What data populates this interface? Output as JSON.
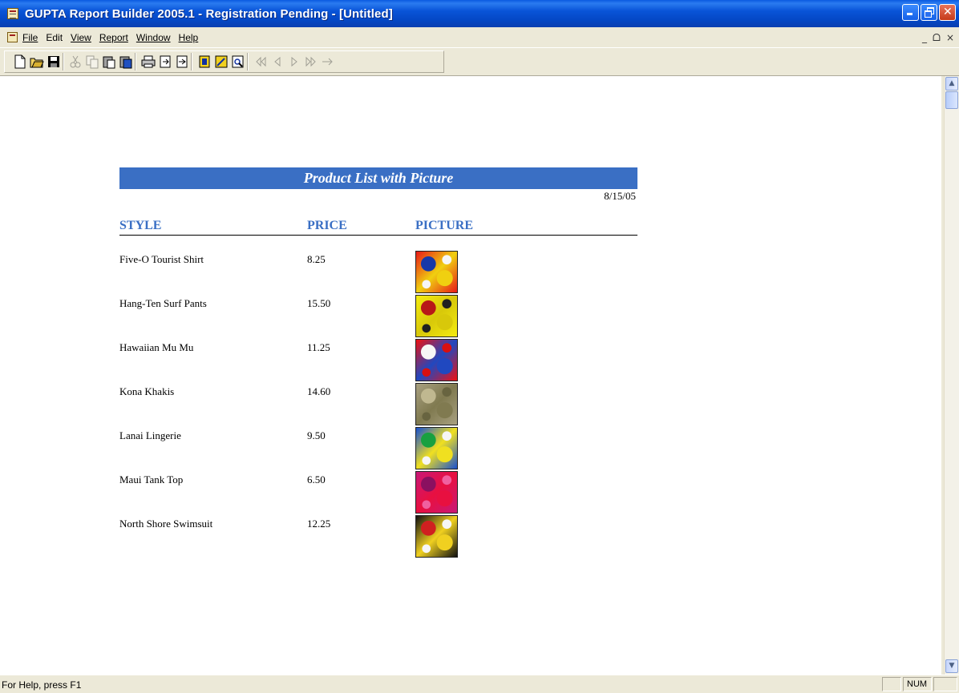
{
  "window": {
    "title": "GUPTA Report Builder 2005.1 - Registration Pending - [Untitled]"
  },
  "menu": {
    "items": [
      {
        "label": "File"
      },
      {
        "label": "Edit"
      },
      {
        "label": "View"
      },
      {
        "label": "Report"
      },
      {
        "label": "Window"
      },
      {
        "label": "Help"
      }
    ],
    "mdi_min": "_",
    "mdi_restore": "ᗝ",
    "mdi_close": "×"
  },
  "toolbar": {
    "icons": [
      "new-icon",
      "open-icon",
      "save-icon",
      "cut-icon",
      "copy-icon",
      "paste-icon",
      "paste-special-icon",
      "print-icon",
      "import-icon",
      "export-icon",
      "help-icon",
      "design-icon",
      "preview-icon",
      "first-page-icon",
      "prev-page-icon",
      "next-page-icon",
      "last-page-icon",
      "goto-page-icon"
    ]
  },
  "report": {
    "title": "Product List with Picture",
    "date": "8/15/05",
    "columns": {
      "style": "STYLE",
      "price": "PRICE",
      "picture": "PICTURE"
    },
    "rows": [
      {
        "style": "Five-O Tourist Shirt",
        "price": "8.25",
        "picture_colors": [
          "#e81818",
          "#f0d010",
          "#1838a8",
          "#f6f6f6"
        ]
      },
      {
        "style": "Hang-Ten Surf Pants",
        "price": "15.50",
        "picture_colors": [
          "#f4ec10",
          "#d8c80a",
          "#b81818",
          "#202020"
        ]
      },
      {
        "style": "Hawaiian Mu Mu",
        "price": "11.25",
        "picture_colors": [
          "#f01010",
          "#2048c0",
          "#f6f6f6",
          "#d81010"
        ]
      },
      {
        "style": "Kona Khakis",
        "price": "14.60",
        "picture_colors": [
          "#a8a080",
          "#807a50",
          "#c0b890",
          "#686440"
        ]
      },
      {
        "style": "Lanai Lingerie",
        "price": "9.50",
        "picture_colors": [
          "#1850d0",
          "#f0e020",
          "#18a040",
          "#f6f6f6"
        ]
      },
      {
        "style": "Maui Tank Top",
        "price": "6.50",
        "picture_colors": [
          "#c81878",
          "#e81040",
          "#8a1060",
          "#f060a0"
        ]
      },
      {
        "style": "North Shore Swimsuit",
        "price": "12.25",
        "picture_colors": [
          "#101010",
          "#f0d020",
          "#d02020",
          "#f6f6f6"
        ]
      }
    ]
  },
  "status": {
    "help_text": "For Help, press F1",
    "num": "NUM"
  }
}
